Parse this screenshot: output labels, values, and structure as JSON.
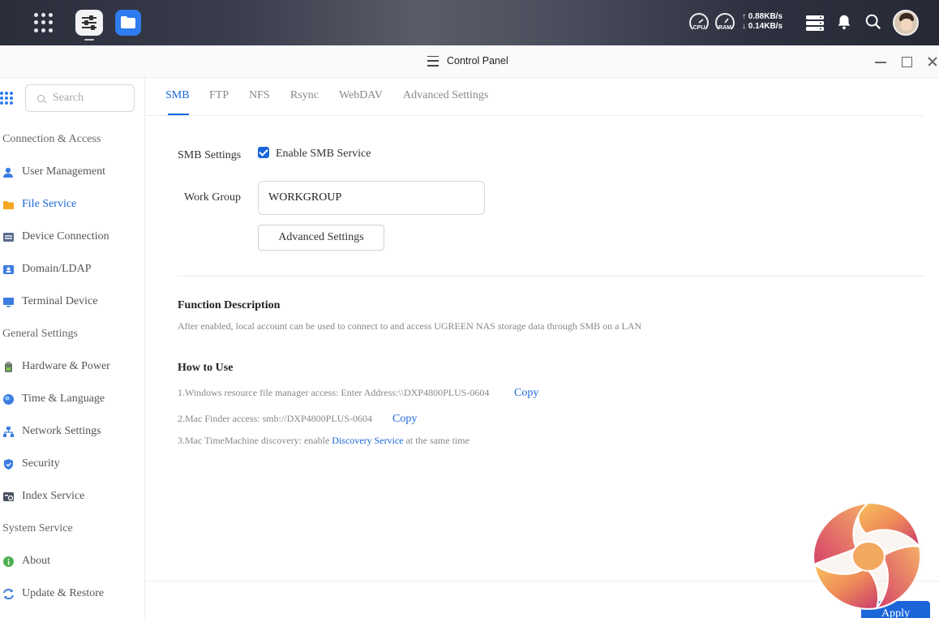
{
  "taskbar": {
    "cpu_label": "CPU",
    "ram_label": "RAM",
    "upload_speed": "↑ 0.88KB/s",
    "download_speed": "↓ 0.14KB/s"
  },
  "window": {
    "title": "Control Panel"
  },
  "sidebar": {
    "search_placeholder": "Search",
    "sections": [
      {
        "label": "Connection & Access",
        "items": [
          {
            "label": "User Management",
            "icon": "user-icon"
          },
          {
            "label": "File Service",
            "icon": "folder-icon",
            "active": true
          },
          {
            "label": "Device Connection",
            "icon": "device-icon"
          },
          {
            "label": "Domain/LDAP",
            "icon": "domain-icon"
          },
          {
            "label": "Terminal Device",
            "icon": "terminal-icon"
          }
        ]
      },
      {
        "label": "General Settings",
        "items": [
          {
            "label": "Hardware & Power",
            "icon": "hardware-icon"
          },
          {
            "label": "Time & Language",
            "icon": "globe-icon"
          },
          {
            "label": "Network Settings",
            "icon": "network-icon"
          },
          {
            "label": "Security",
            "icon": "shield-icon"
          },
          {
            "label": "Index Service",
            "icon": "index-icon"
          }
        ]
      },
      {
        "label": "System Service",
        "items": [
          {
            "label": "About",
            "icon": "info-icon"
          },
          {
            "label": "Update & Restore",
            "icon": "refresh-icon"
          }
        ]
      }
    ]
  },
  "tabs": [
    "SMB",
    "FTP",
    "NFS",
    "Rsync",
    "WebDAV",
    "Advanced Settings"
  ],
  "active_tab": "SMB",
  "smb": {
    "settings_label": "SMB Settings",
    "enable_label": "Enable SMB Service",
    "enabled": true,
    "workgroup_label": "Work Group",
    "workgroup_value": "WORKGROUP",
    "advanced_button": "Advanced Settings"
  },
  "function_description": {
    "title": "Function Description",
    "text": "After enabled, local account can be used to connect to and access UGREEN NAS storage data through SMB on a LAN"
  },
  "how_to_use": {
    "title": "How to Use",
    "step1": "1.Windows resource file manager access: Enter Address:\\\\DXP4800PLUS-0604",
    "step2": "2.Mac Finder access: smb://DXP4800PLUS-0604",
    "step3_prefix": "3.Mac TimeMachine discovery: enable ",
    "step3_link": "Discovery Service",
    "step3_suffix": " at the same time",
    "copy_label": "Copy"
  },
  "footer": {
    "apply_label": "Apply"
  },
  "colors": {
    "accent": "#1a66d9",
    "taskbar": "#2e3240"
  }
}
